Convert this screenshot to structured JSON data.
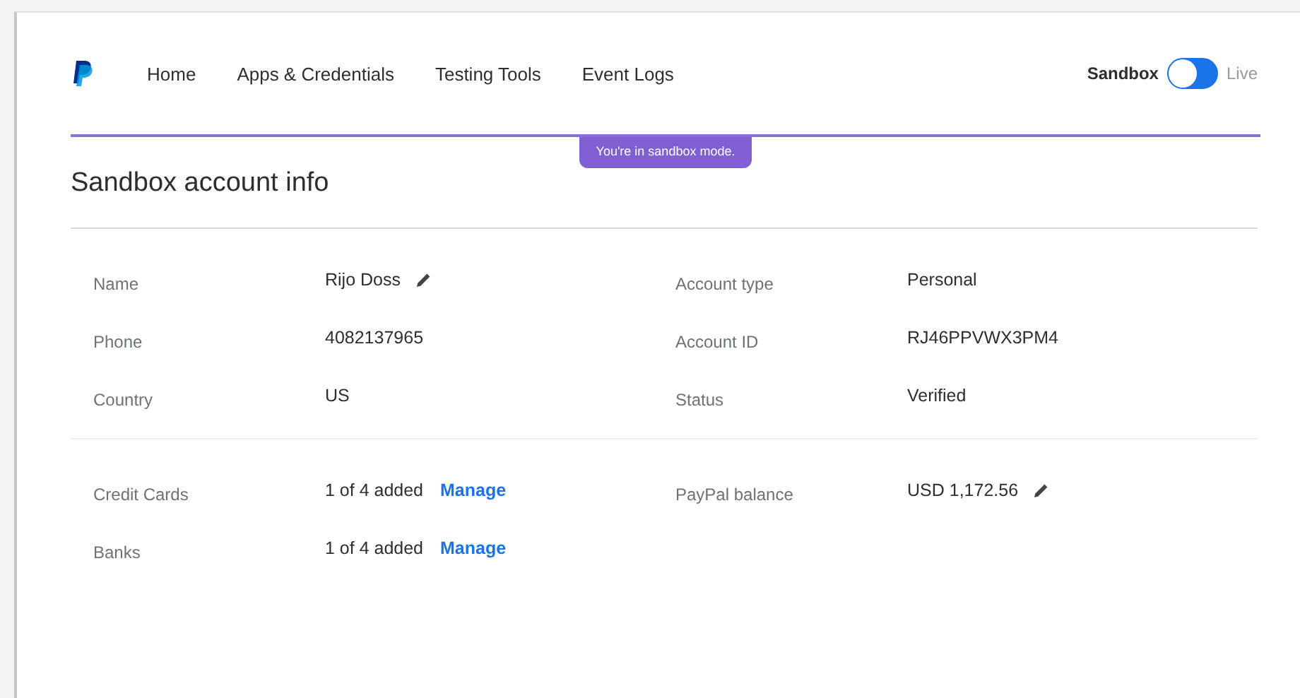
{
  "nav": {
    "items": [
      {
        "label": "Home"
      },
      {
        "label": "Apps & Credentials"
      },
      {
        "label": "Testing Tools"
      },
      {
        "label": "Event Logs"
      }
    ]
  },
  "mode_toggle": {
    "label_off": "Sandbox",
    "label_on": "Live",
    "on": false
  },
  "banner": "You're in sandbox mode.",
  "title": "Sandbox account info",
  "sections": [
    {
      "left": [
        {
          "label": "Name",
          "value": "Rijo Doss",
          "editable": true
        },
        {
          "label": "Phone",
          "value": "4082137965",
          "editable": false
        },
        {
          "label": "Country",
          "value": "US",
          "editable": false
        }
      ],
      "right": [
        {
          "label": "Account type",
          "value": "Personal",
          "editable": false
        },
        {
          "label": "Account ID",
          "value": "RJ46PPVWX3PM4",
          "editable": false
        },
        {
          "label": "Status",
          "value": "Verified",
          "editable": false
        }
      ]
    },
    {
      "left": [
        {
          "label": "Credit Cards",
          "value": "1 of 4 added",
          "link": "Manage",
          "editable": false
        },
        {
          "label": "Banks",
          "value": "1 of 4 added",
          "link": "Manage",
          "editable": false
        }
      ],
      "right": [
        {
          "label": "PayPal balance",
          "value": "USD 1,172.56",
          "editable": true
        }
      ]
    }
  ]
}
